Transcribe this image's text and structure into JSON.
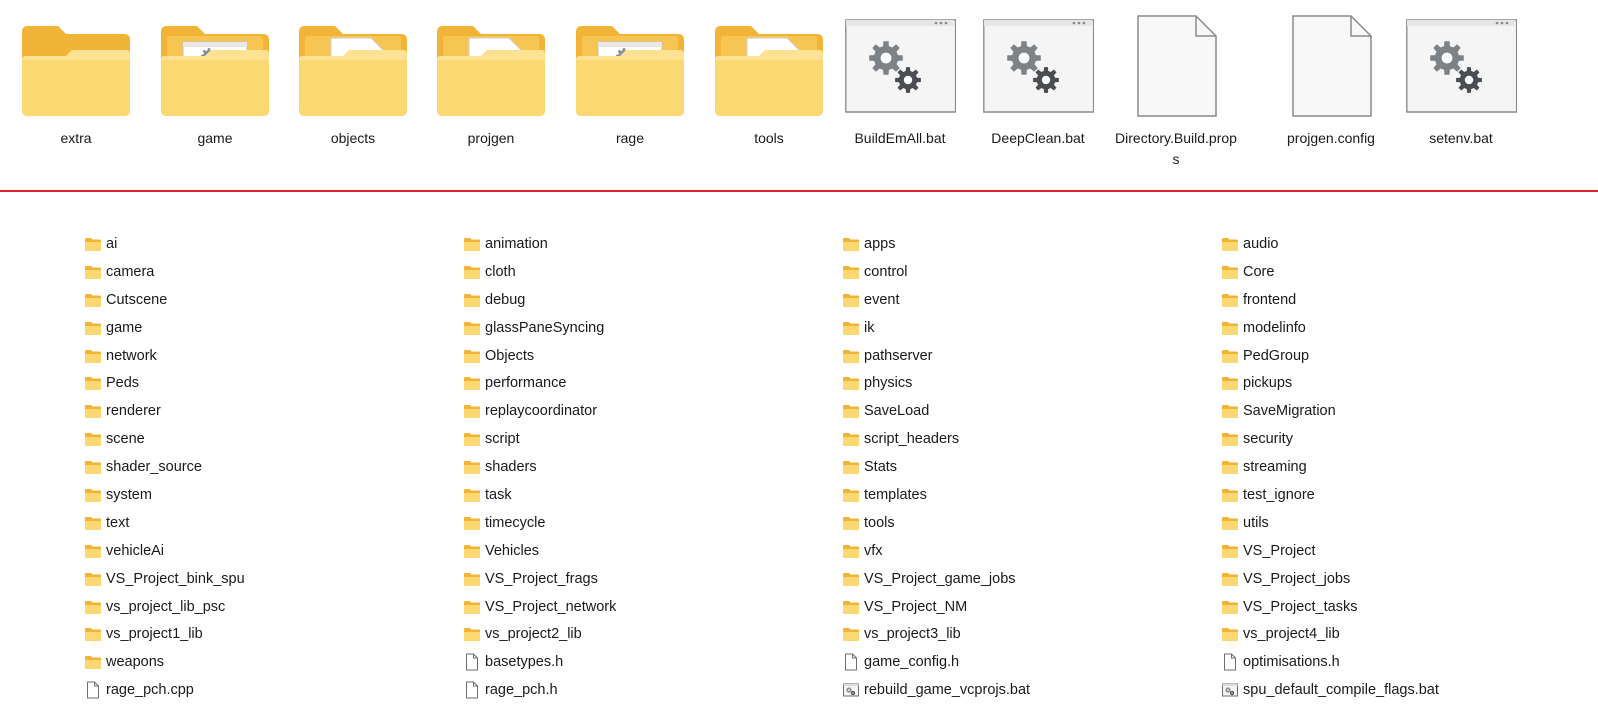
{
  "top_items": [
    {
      "label": "extra",
      "icon": "folder-icon",
      "kind": "folder-empty"
    },
    {
      "label": "game",
      "icon": "folder-icon",
      "kind": "folder-gear"
    },
    {
      "label": "objects",
      "icon": "folder-icon",
      "kind": "folder-doc"
    },
    {
      "label": "projgen",
      "icon": "folder-icon",
      "kind": "folder-doc"
    },
    {
      "label": "rage",
      "icon": "folder-icon",
      "kind": "folder-gear"
    },
    {
      "label": "tools",
      "icon": "folder-icon",
      "kind": "folder-doc"
    },
    {
      "label": "BuildEmAll.bat",
      "icon": "batch-file-icon",
      "kind": "bat"
    },
    {
      "label": "DeepClean.bat",
      "icon": "batch-file-icon",
      "kind": "bat"
    },
    {
      "label": "Directory.Build.props",
      "icon": "file-icon",
      "kind": "file"
    },
    {
      "label": "projgen.config",
      "icon": "file-icon",
      "kind": "file"
    },
    {
      "label": "setenv.bat",
      "icon": "batch-file-icon",
      "kind": "bat"
    }
  ],
  "list_columns": [
    [
      {
        "label": "ai",
        "kind": "folder"
      },
      {
        "label": "camera",
        "kind": "folder"
      },
      {
        "label": "Cutscene",
        "kind": "folder"
      },
      {
        "label": "game",
        "kind": "folder"
      },
      {
        "label": "network",
        "kind": "folder"
      },
      {
        "label": "Peds",
        "kind": "folder"
      },
      {
        "label": "renderer",
        "kind": "folder"
      },
      {
        "label": "scene",
        "kind": "folder"
      },
      {
        "label": "shader_source",
        "kind": "folder"
      },
      {
        "label": "system",
        "kind": "folder"
      },
      {
        "label": "text",
        "kind": "folder"
      },
      {
        "label": "vehicleAi",
        "kind": "folder"
      },
      {
        "label": "VS_Project_bink_spu",
        "kind": "folder"
      },
      {
        "label": "vs_project_lib_psc",
        "kind": "folder"
      },
      {
        "label": "vs_project1_lib",
        "kind": "folder"
      },
      {
        "label": "weapons",
        "kind": "folder"
      },
      {
        "label": "rage_pch.cpp",
        "kind": "file"
      }
    ],
    [
      {
        "label": "animation",
        "kind": "folder"
      },
      {
        "label": "cloth",
        "kind": "folder"
      },
      {
        "label": "debug",
        "kind": "folder"
      },
      {
        "label": "glassPaneSyncing",
        "kind": "folder"
      },
      {
        "label": "Objects",
        "kind": "folder"
      },
      {
        "label": "performance",
        "kind": "folder"
      },
      {
        "label": "replaycoordinator",
        "kind": "folder"
      },
      {
        "label": "script",
        "kind": "folder"
      },
      {
        "label": "shaders",
        "kind": "folder"
      },
      {
        "label": "task",
        "kind": "folder"
      },
      {
        "label": "timecycle",
        "kind": "folder"
      },
      {
        "label": "Vehicles",
        "kind": "folder"
      },
      {
        "label": "VS_Project_frags",
        "kind": "folder"
      },
      {
        "label": "VS_Project_network",
        "kind": "folder"
      },
      {
        "label": "vs_project2_lib",
        "kind": "folder"
      },
      {
        "label": "basetypes.h",
        "kind": "file"
      },
      {
        "label": "rage_pch.h",
        "kind": "file"
      }
    ],
    [
      {
        "label": "apps",
        "kind": "folder"
      },
      {
        "label": "control",
        "kind": "folder"
      },
      {
        "label": "event",
        "kind": "folder"
      },
      {
        "label": "ik",
        "kind": "folder"
      },
      {
        "label": "pathserver",
        "kind": "folder"
      },
      {
        "label": "physics",
        "kind": "folder"
      },
      {
        "label": "SaveLoad",
        "kind": "folder"
      },
      {
        "label": "script_headers",
        "kind": "folder"
      },
      {
        "label": "Stats",
        "kind": "folder"
      },
      {
        "label": "templates",
        "kind": "folder"
      },
      {
        "label": "tools",
        "kind": "folder"
      },
      {
        "label": "vfx",
        "kind": "folder"
      },
      {
        "label": "VS_Project_game_jobs",
        "kind": "folder"
      },
      {
        "label": "VS_Project_NM",
        "kind": "folder"
      },
      {
        "label": "vs_project3_lib",
        "kind": "folder"
      },
      {
        "label": "game_config.h",
        "kind": "file"
      },
      {
        "label": "rebuild_game_vcprojs.bat",
        "kind": "bat"
      }
    ],
    [
      {
        "label": "audio",
        "kind": "folder"
      },
      {
        "label": "Core",
        "kind": "folder"
      },
      {
        "label": "frontend",
        "kind": "folder"
      },
      {
        "label": "modelinfo",
        "kind": "folder"
      },
      {
        "label": "PedGroup",
        "kind": "folder"
      },
      {
        "label": "pickups",
        "kind": "folder"
      },
      {
        "label": "SaveMigration",
        "kind": "folder"
      },
      {
        "label": "security",
        "kind": "folder"
      },
      {
        "label": "streaming",
        "kind": "folder"
      },
      {
        "label": "test_ignore",
        "kind": "folder"
      },
      {
        "label": "utils",
        "kind": "folder"
      },
      {
        "label": "VS_Project",
        "kind": "folder"
      },
      {
        "label": "VS_Project_jobs",
        "kind": "folder"
      },
      {
        "label": "VS_Project_tasks",
        "kind": "folder"
      },
      {
        "label": "vs_project4_lib",
        "kind": "folder"
      },
      {
        "label": "optimisations.h",
        "kind": "file"
      },
      {
        "label": "spu_default_compile_flags.bat",
        "kind": "bat"
      }
    ]
  ],
  "colors": {
    "folder_back": "#f2b437",
    "folder_front": "#fcd873",
    "folder_front_light": "#fde7a2",
    "divider": "#d8262c",
    "gear": "#7d8287",
    "gear_dark": "#4a4e52"
  }
}
